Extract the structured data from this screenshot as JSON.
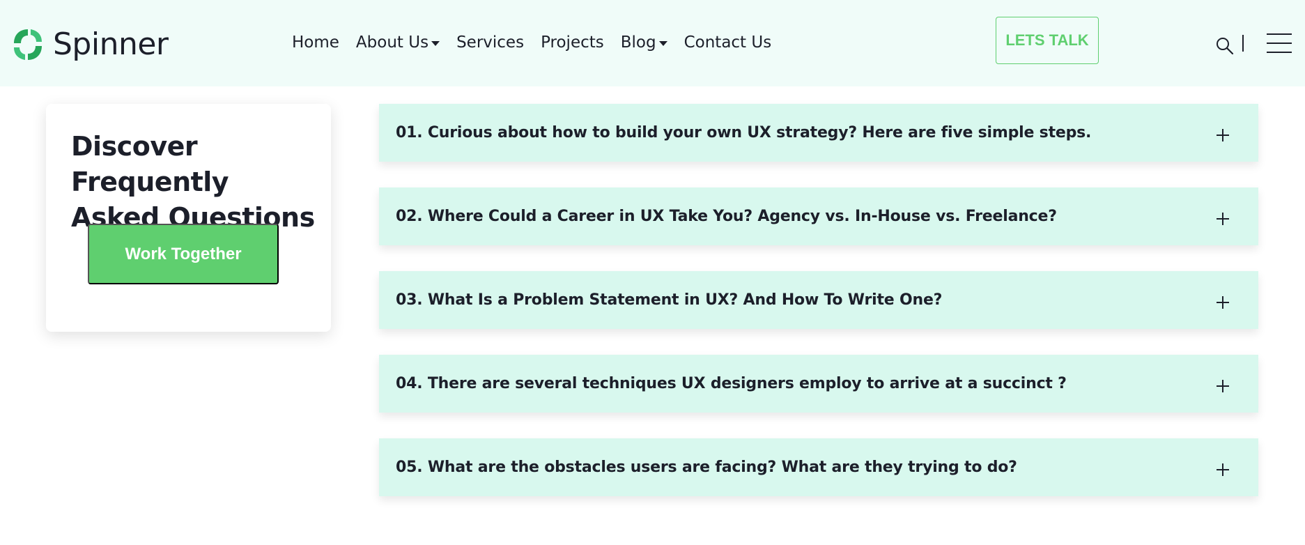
{
  "brand": {
    "name": "Spinner",
    "icon": "spinner-logo-icon",
    "accent_color": "#5fcf6f"
  },
  "nav": {
    "items": [
      {
        "label": "Home",
        "dropdown": false
      },
      {
        "label": "About Us",
        "dropdown": true
      },
      {
        "label": "Services",
        "dropdown": false
      },
      {
        "label": "Projects",
        "dropdown": false
      },
      {
        "label": "Blog",
        "dropdown": true
      },
      {
        "label": "Contact Us",
        "dropdown": false
      }
    ]
  },
  "header": {
    "cta_label": "LETS TALK",
    "search_icon": "search-icon",
    "menu_icon": "hamburger-menu-icon"
  },
  "sidebar": {
    "title": "Discover Frequently Asked Questions",
    "button_label": "Work Together"
  },
  "faq": {
    "toggle_icon": "plus-icon",
    "items": [
      {
        "question": "01. Curious about how to build your own UX strategy? Here are five simple steps."
      },
      {
        "question": "02. Where Could a Career in UX Take You? Agency vs. In-House vs. Freelance?"
      },
      {
        "question": "03. What Is a Problem Statement in UX? And How To Write One?"
      },
      {
        "question": "04. There are several techniques UX designers employ to arrive at a succinct ?"
      },
      {
        "question": "05. What are the obstacles users are facing? What are they trying to do?"
      }
    ]
  }
}
